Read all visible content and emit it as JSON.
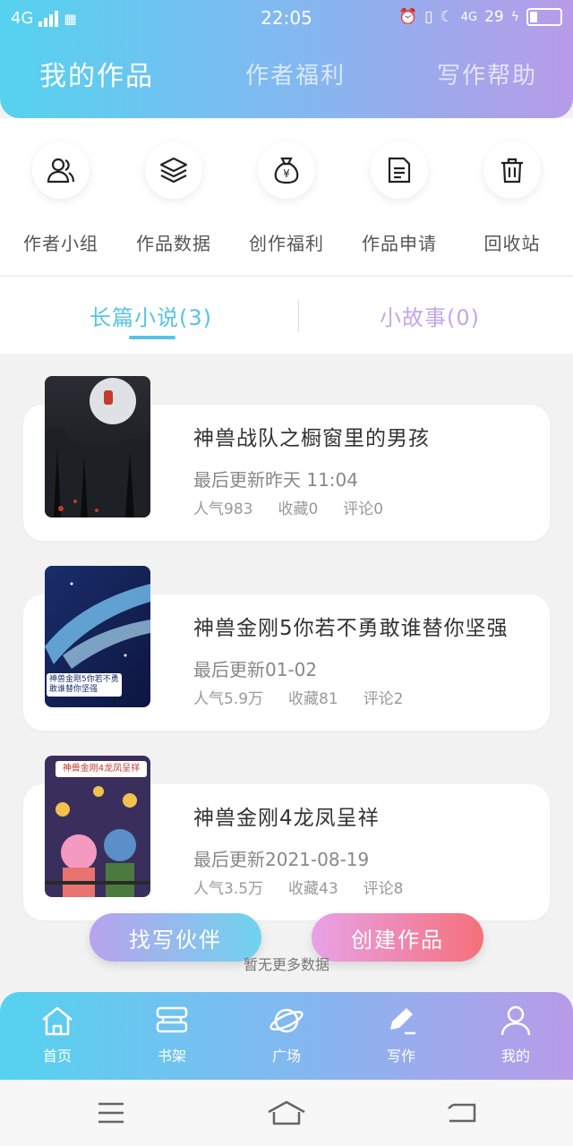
{
  "status_bar": {
    "network": "4G",
    "time": "22:05",
    "right_network": "4G",
    "battery_pct": "29"
  },
  "header_tabs": [
    {
      "label": "我的作品",
      "active": true
    },
    {
      "label": "作者福利",
      "active": false
    },
    {
      "label": "写作帮助",
      "active": false
    }
  ],
  "quick_actions": [
    {
      "label": "作者小组",
      "icon": "people-icon"
    },
    {
      "label": "作品数据",
      "icon": "layers-icon"
    },
    {
      "label": "创作福利",
      "icon": "money-bag-icon"
    },
    {
      "label": "作品申请",
      "icon": "document-icon"
    },
    {
      "label": "回收站",
      "icon": "trash-icon"
    }
  ],
  "category_tabs": [
    {
      "label": "长篇小说(3)",
      "active": true
    },
    {
      "label": "小故事(0)",
      "active": false
    }
  ],
  "works": [
    {
      "title": "神兽战队之橱窗里的男孩",
      "updated": "最后更新昨天 11:04",
      "popularity": "人气983",
      "favorites": "收藏0",
      "comments": "评论0"
    },
    {
      "title": "神兽金刚5你若不勇敢谁替你坚强",
      "updated": "最后更新01-02",
      "popularity": "人气5.9万",
      "favorites": "收藏81",
      "comments": "评论2",
      "cover_caption": "神兽金刚5你若不勇敢谁替你坚强"
    },
    {
      "title": "神兽金刚4龙凤呈祥",
      "updated": "最后更新2021-08-19",
      "popularity": "人气3.5万",
      "favorites": "收藏43",
      "comments": "评论8",
      "cover_caption": "神兽金刚4龙凤呈祥"
    }
  ],
  "buttons": {
    "find_partner": "找写伙伴",
    "create_work": "创建作品"
  },
  "no_more": "暂无更多数据",
  "bottom_nav": [
    {
      "label": "首页",
      "icon": "home-icon"
    },
    {
      "label": "书架",
      "icon": "bookshelf-icon"
    },
    {
      "label": "广场",
      "icon": "planet-icon"
    },
    {
      "label": "写作",
      "icon": "pen-icon",
      "active": true
    },
    {
      "label": "我的",
      "icon": "user-icon"
    }
  ],
  "colors": {
    "gradient_start": "#55d2ef",
    "gradient_end": "#b89be8",
    "tab_active": "#55c3e8",
    "tab_inactive": "#c2a6ec",
    "partner_btn_start": "#b9a2ec",
    "partner_btn_end": "#6fd3ef",
    "create_btn_start": "#e8a2e8",
    "create_btn_end": "#f5707a"
  }
}
